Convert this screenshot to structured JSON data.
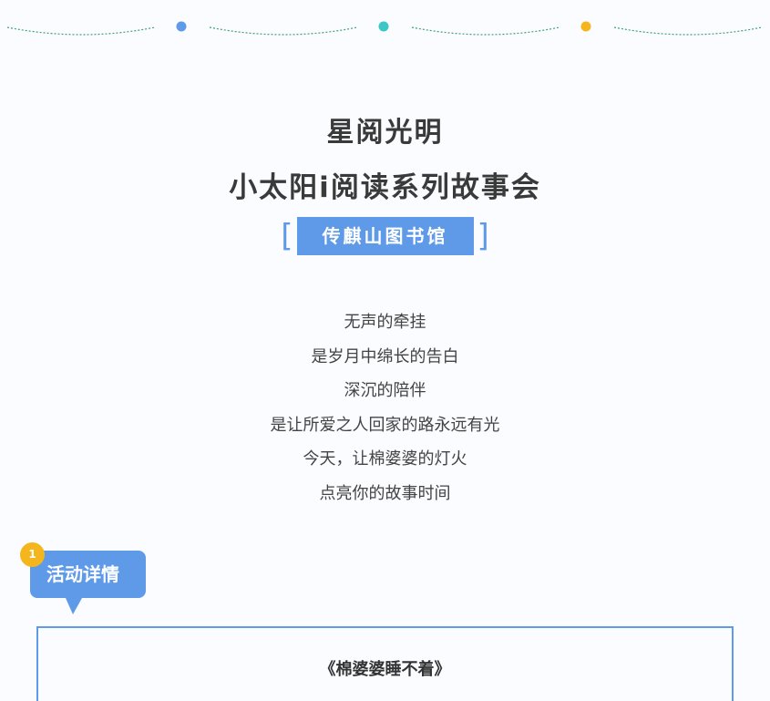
{
  "colors": {
    "accent_blue": "#5f9ae8",
    "dot_blue": "#5f9ae8",
    "dot_teal": "#3cc6c6",
    "dot_yellow": "#f5b51c",
    "dash_green": "#3fa371"
  },
  "header": {
    "title_line1": "星阅光明",
    "title_line2": "小太阳i阅读系列故事会",
    "venue": "传麒山图书馆",
    "bracket_left": "[",
    "bracket_right": "]"
  },
  "poem": {
    "lines": [
      "无声的牵挂",
      "是岁月中绵长的告白",
      "深沉的陪伴",
      "是让所爱之人回家的路永远有光",
      "今天，让棉婆婆的灯火",
      "点亮你的故事时间"
    ]
  },
  "section": {
    "number": "1",
    "label": "活动详情"
  },
  "detail": {
    "book_title": "《棉婆婆睡不着》"
  }
}
